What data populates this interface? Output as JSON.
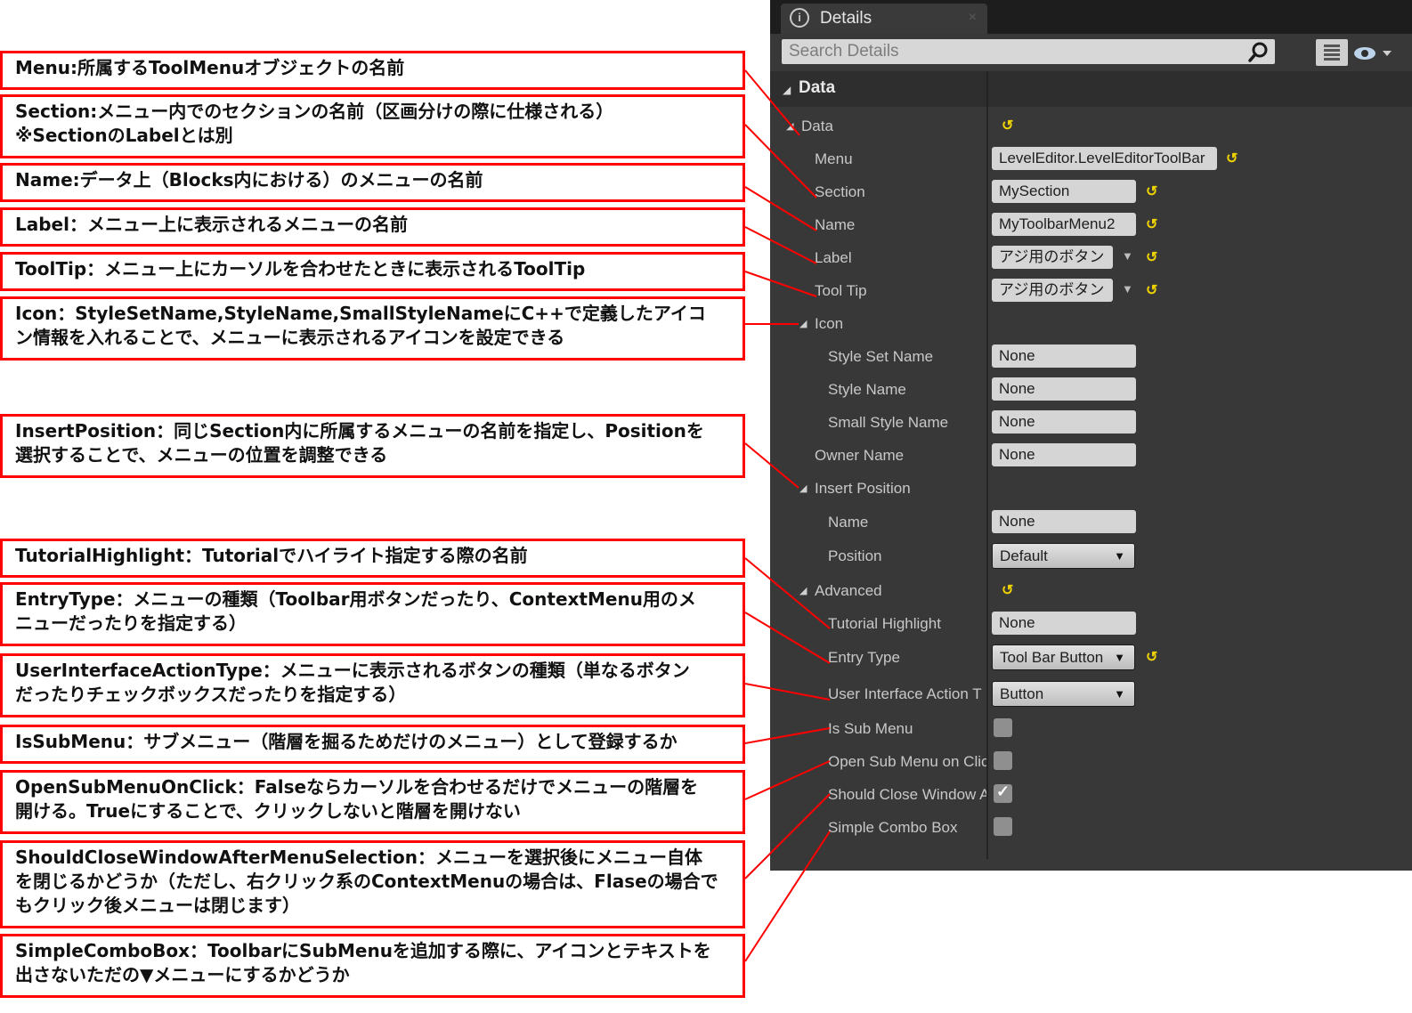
{
  "annotations": [
    {
      "id": "menu",
      "text": "Menu:所属するToolMenuオブジェクトの名前"
    },
    {
      "id": "section",
      "text": "Section:メニュー内でのセクションの名前（区画分けの際に仕様される）\n※SectionのLabelとは別"
    },
    {
      "id": "name",
      "text": "Name:データ上（Blocks内における）のメニューの名前"
    },
    {
      "id": "label",
      "text": "Label：メニュー上に表示されるメニューの名前"
    },
    {
      "id": "tooltip",
      "text": "ToolTip：メニュー上にカーソルを合わせたときに表示されるToolTip"
    },
    {
      "id": "icon",
      "text": "Icon：StyleSetName,StyleName,SmallStyleNameにC++で定義したアイコ\nン情報を入れることで、メニューに表示されるアイコンを設定できる"
    },
    {
      "id": "insertposition",
      "text": "InsertPosition：同じSection内に所属するメニューの名前を指定し、Positionを\n選択することで、メニューの位置を調整できる"
    },
    {
      "id": "tutorialhighlight",
      "text": "TutorialHighlight：Tutorialでハイライト指定する際の名前"
    },
    {
      "id": "entrytype",
      "text": "EntryType：メニューの種類（Toolbar用ボタンだったり、ContextMenu用のメ\nニューだったりを指定する）"
    },
    {
      "id": "uiactiontype",
      "text": "UserInterfaceActionType：メニューに表示されるボタンの種類（単なるボタン\nだったりチェックボックスだったりを指定する）"
    },
    {
      "id": "issubmenu",
      "text": "IsSubMenu：サブメニュー（階層を掘るためだけのメニュー）として登録するか"
    },
    {
      "id": "opensubmenu",
      "text": "OpenSubMenuOnClick：Falseならカーソルを合わせるだけでメニューの階層を\n開ける。Trueにすることで、クリックしないと階層を開けない"
    },
    {
      "id": "shouldclose",
      "text": "ShouldCloseWindowAfterMenuSelection：メニューを選択後にメニュー自体\nを閉じるかどうか（ただし、右クリック系のContextMenuの場合は、Flaseの場合で\nもクリック後メニューは閉じます）"
    },
    {
      "id": "simplecombo",
      "text": "SimpleComboBox：ToolbarにSubMenuを追加する際に、アイコンとテキストを\n出さないただの▼メニューにするかどうか"
    }
  ],
  "panel": {
    "tab_title": "Details",
    "tab_icon": "info-icon",
    "close_glyph": "×",
    "search_placeholder": "Search Details",
    "category_header": "Data",
    "reset_glyph": "↺",
    "rows": {
      "data": {
        "label": "Data"
      },
      "menu": {
        "label": "Menu",
        "value": "LevelEditor.LevelEditorToolBar"
      },
      "section": {
        "label": "Section",
        "value": "MySection"
      },
      "name": {
        "label": "Name",
        "value": "MyToolbarMenu2"
      },
      "label": {
        "label": "Label",
        "value": "アジ用のボタン"
      },
      "tooltip": {
        "label": "Tool Tip",
        "value": "アジ用のボタン"
      },
      "icon": {
        "label": "Icon"
      },
      "style_set_name": {
        "label": "Style Set Name",
        "value": "None"
      },
      "style_name": {
        "label": "Style Name",
        "value": "None"
      },
      "small_style_name": {
        "label": "Small Style Name",
        "value": "None"
      },
      "owner_name": {
        "label": "Owner Name",
        "value": "None"
      },
      "insert_position": {
        "label": "Insert Position"
      },
      "ip_name": {
        "label": "Name",
        "value": "None"
      },
      "ip_position": {
        "label": "Position",
        "value": "Default"
      },
      "advanced": {
        "label": "Advanced"
      },
      "tutorial_highlight": {
        "label": "Tutorial Highlight",
        "value": "None"
      },
      "entry_type": {
        "label": "Entry Type",
        "value": "Tool Bar Button"
      },
      "ui_action_type": {
        "label": "User Interface Action T",
        "value": "Button"
      },
      "is_sub_menu": {
        "label": "Is Sub Menu",
        "checked": false
      },
      "open_sub_menu": {
        "label": "Open Sub Menu on Clic",
        "checked": false
      },
      "should_close": {
        "label": "Should Close Window A",
        "checked": true
      },
      "simple_combo": {
        "label": "Simple Combo Box",
        "checked": false
      }
    }
  },
  "colors": {
    "annotation_border": "#ff0000",
    "panel_bg": "#383838",
    "reset_arrow": "#f0d400"
  }
}
